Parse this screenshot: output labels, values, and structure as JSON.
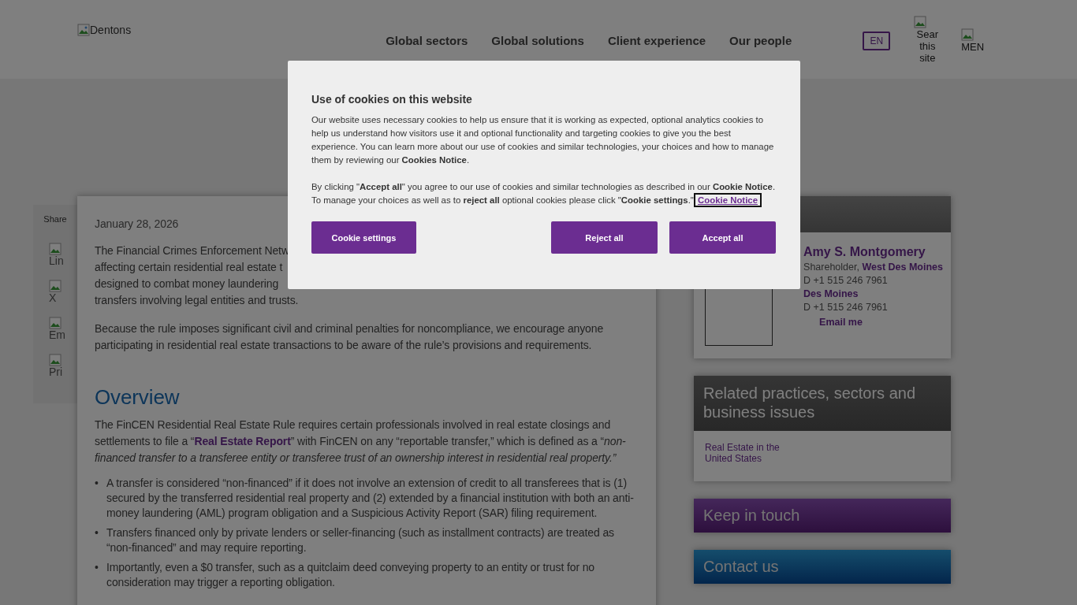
{
  "header": {
    "logo_alt": "Dentons",
    "nav": [
      "Global sectors",
      "Global solutions",
      "Client experience",
      "Our people"
    ],
    "language": "EN",
    "search_alt": "Sear this site",
    "menu_alt": "MEN"
  },
  "share": {
    "label": "Share",
    "items": [
      "Lin",
      "X",
      "Em",
      "Pri"
    ]
  },
  "article": {
    "date": "January 28, 2026",
    "intro_lines": [
      "The Financial Crimes Enforcement Netw",
      "affecting certain residential real estate t",
      "designed to combat money laundering",
      "transfers involving legal entities and trusts."
    ],
    "paragraph": "Because the rule imposes significant civil and criminal penalties for noncompliance, we encourage anyone participating in residential real estate transactions to be aware of the rule’s provisions and requirements.",
    "heading": "Overview",
    "overview": {
      "text_before": "The FinCEN Residential Real Estate Rule requires certain professionals involved in real estate closings and settlements to file a “",
      "link": "Real Estate Report",
      "text_after": "” with FinCEN on any “reportable transfer,” which is defined as a “",
      "italic": "non-financed transfer to a transferee entity or transferee trust of an ownership interest in residential real property.”"
    },
    "bullet_marker": "•",
    "bullets": [
      "A transfer is considered “non-financed” if it does not involve an extension of credit to all transferees that is (1) secured by the transferred residential real property and (2) extended by a financial institution with both an anti-money laundering (AML) program obligation and a Suspicious Activity Report (SAR) filing requirement.",
      "Transfers financed only by private lenders or seller-financing (such as installment contracts) are treated as “non-financed” and may require reporting.",
      "Importantly, even a $0 transfer, such as a quitclaim deed conveying property to an entity or trust for no consideration may trigger a reporting obligation."
    ]
  },
  "sidebar": {
    "contact": {
      "name": "Amy S. Montgomery",
      "title": "Shareholder,",
      "office": "West Des Moines",
      "phone": "D +1 515 246 7961",
      "office_2": "Des Moines",
      "phone_2": "D +1 515 246 7961",
      "email": "Email me"
    },
    "related": {
      "title": "Related practices, sectors and business issues",
      "links": [
        "Real Estate in the United States"
      ]
    },
    "keep_in_touch": "Keep in touch",
    "contact_us": "Contact us"
  },
  "cookie_dialog": {
    "title": "Use of cookies on this website",
    "paragraph_1": "Our website uses necessary cookies to help us ensure that it is working as expected, optional analytics cookies to help us understand how visitors use it and optional functionality and targeting cookies to give you the best experience. You can learn more about our use of cookies and similar technologies, your choices and how to manage them by reviewing our **Cookies Notice**.",
    "paragraph_2": "By clicking \"**Accept all**\" you agree to our use of cookies and similar technologies as described in our **Cookie Notice**. To manage your choices as well as to **reject all** optional cookies please click \"**Cookie settings**.\"",
    "link": "Cookie Notice",
    "buttons": [
      "Cookie settings",
      "Reject all",
      "Accept all"
    ]
  }
}
